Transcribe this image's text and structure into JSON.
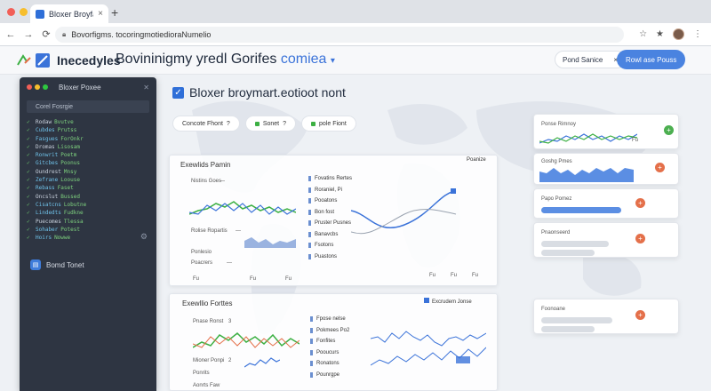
{
  "browser": {
    "tab_title": "Bloxer Broyfavr",
    "tab_close": "×",
    "new_tab": "+",
    "url": "Bovorfigms. tocoringmotiedioraNumelio",
    "nav": {
      "back": "←",
      "forward": "→",
      "reload": "⟳"
    }
  },
  "header": {
    "brand": "Inecedyles",
    "title_main": "Bovininigmy yredl Gorifes",
    "title_accent": "comiea",
    "title_caret": "▾",
    "pill_label": "Pond Sanice",
    "pill_close": "×",
    "button_label": "Rowl ase Pouss"
  },
  "sidebar": {
    "title": "Bloxer Poxee",
    "close": "✕",
    "filter": "Corel Fosrgie",
    "footer_label": "Bomd Tonet",
    "code_lines": [
      {
        "mk": "✓",
        "a": "Rodaw",
        "b": "Bvutve"
      },
      {
        "mk": "✓",
        "a": "Cubdes",
        "b": "Prutss"
      },
      {
        "mk": "✓",
        "a": "Fasgues",
        "b": "ForOnkr"
      },
      {
        "mk": "✓",
        "a": "Dromas",
        "b": "Lisosam"
      },
      {
        "mk": "✓",
        "a": "Ronwrit",
        "b": "Poetm"
      },
      {
        "mk": "✓",
        "a": "Gitcbes",
        "b": "Poonus"
      },
      {
        "mk": "✓",
        "a": "Oundrest",
        "b": "Mnsy"
      },
      {
        "mk": "✓",
        "a": "Zefrane",
        "b": "Loouse"
      },
      {
        "mk": "✓",
        "a": "Rebass",
        "b": "Faset"
      },
      {
        "mk": "✓",
        "a": "Oncslut",
        "b": "Bussed"
      },
      {
        "mk": "✓",
        "a": "Cisatcns",
        "b": "Lobutne"
      },
      {
        "mk": "✓",
        "a": "Lindedts",
        "b": "Fudkne"
      },
      {
        "mk": "✓",
        "a": "Puecomes",
        "b": "Tlessa"
      },
      {
        "mk": "✓",
        "a": "Sohaber",
        "b": "Potest"
      },
      {
        "mk": "✓",
        "a": "Hoirs",
        "b": "Nowwe"
      }
    ]
  },
  "main": {
    "title": "Bloxer broymart.eotioot nont",
    "chips": [
      {
        "label": "Concote Fhont",
        "suffix": "?"
      },
      {
        "label": "Sonet",
        "suffix": "?"
      },
      {
        "label": "pole Fiont",
        "suffix": ""
      }
    ],
    "panel1": {
      "title": "Exewlids Pamin",
      "tag": "Poanize",
      "rows": [
        {
          "label": "Nistins Goes",
          "dash": "—"
        },
        {
          "label": "Rolise Ropartis",
          "dash": "—"
        },
        {
          "label": "Ponlesio",
          "dash": ""
        },
        {
          "label": "Poacrers",
          "dash": "—"
        }
      ],
      "axis": [
        "Fu",
        "Fu",
        "Fu"
      ],
      "list": [
        "Fovatins Rertes",
        "Roraniel, Pi",
        "Pooatons",
        "Bon fost",
        "Pruster Pusnes",
        "Banavcbs",
        "Fsotons",
        "Puastons"
      ],
      "axis2": [
        "Fu",
        "Fu",
        "Fu"
      ]
    },
    "panel2": {
      "title": "Exewllio Forttes",
      "tag": "Excrudem Jonse",
      "rows": [
        {
          "label": "Pnase Ronst",
          "suffix": "3"
        },
        {
          "label": "Mioner Ponpi",
          "suffix": "2"
        },
        {
          "label": "Ponrits",
          "suffix": ""
        },
        {
          "label": "Aonrts Faw",
          "suffix": ""
        }
      ],
      "list": [
        "Fpose nelse",
        "Pokmees Po2",
        "Fonfites",
        "Pooucurs",
        "Ronatons",
        "Pounrgpe"
      ]
    }
  },
  "right_cards": [
    {
      "label": "Ponse Rimnoy",
      "btn_color": "#4caf50",
      "btn_glyph": "+"
    },
    {
      "label": "Goshg Pmes",
      "btn_color": "#e4704a",
      "btn_glyph": "+"
    },
    {
      "label": "Papo Pomez",
      "btn_color": "#e4704a",
      "btn_glyph": "+"
    },
    {
      "label": "Pnaonseerd",
      "btn_color": "#e4704a",
      "btn_glyph": "+"
    },
    {
      "label": "Foonoane",
      "btn_color": "#e4704a",
      "btn_glyph": "+"
    }
  ],
  "colors": {
    "accent": "#3b73d9",
    "dark_panel": "#2e3542",
    "green": "#3cb043",
    "blue_series": "#3b73d9",
    "orange": "#e4704a"
  }
}
